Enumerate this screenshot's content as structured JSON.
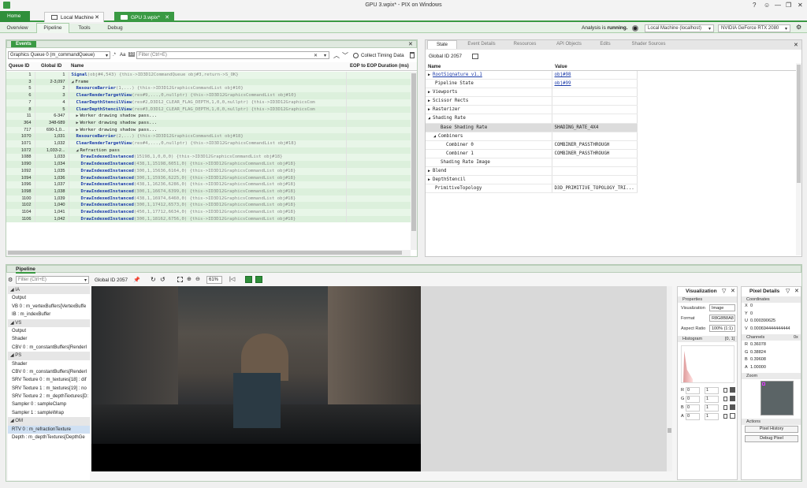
{
  "window": {
    "title": "GPU 3.wpix* - PIX on Windows",
    "help": "?",
    "min": "—",
    "max": "❐",
    "close": "✕"
  },
  "tabs": {
    "home": "Home",
    "docs": [
      {
        "label": "Local Machine"
      },
      {
        "label": "GPU 3.wpix*"
      }
    ]
  },
  "ribbon": {
    "tabs": [
      "Overview",
      "Pipeline",
      "Tools",
      "Debug"
    ],
    "analysis_prefix": "Analysis is",
    "analysis_state": "running.",
    "machine": "Local Machine (localhost)",
    "adapter": "NVIDIA GeForce RTX 2080"
  },
  "events": {
    "title": "Events",
    "queue": "Graphics Queue 0 (m_commandQueue)",
    "regex": ".*",
    "case": "Aa",
    "whole": "10",
    "filter_placeholder": "Filter (Ctrl+E)",
    "collect": "Collect Timing Data",
    "columns": [
      "Queue ID",
      "Global ID",
      "Name",
      "EOP to EOP Duration (ms)"
    ],
    "rows": [
      {
        "q": "1",
        "g": "1",
        "indent": 0,
        "exp": "",
        "fn": "Signal",
        "args": "(obj#4,543)  {this->ID3D12CommandQueue obj#3,return->S_OK}",
        "plain": ""
      },
      {
        "q": "3",
        "g": "2-3,097",
        "indent": 0,
        "exp": "◢",
        "fn": "",
        "args": "",
        "plain": "Frame"
      },
      {
        "q": "5",
        "g": "2",
        "indent": 1,
        "exp": "",
        "fn": "ResourceBarrier",
        "args": "(1,...)  {this->ID3D12GraphicsCommandList obj#10}",
        "plain": ""
      },
      {
        "q": "6",
        "g": "3",
        "indent": 1,
        "exp": "",
        "fn": "ClearRenderTargetView",
        "args": "(res#9,...,0,nullptr)  {this->ID3D12GraphicsCommandList obj#10}",
        "plain": ""
      },
      {
        "q": "7",
        "g": "4",
        "indent": 1,
        "exp": "",
        "fn": "ClearDepthStencilView",
        "args": "(res#2,D3D12_CLEAR_FLAG_DEPTH,1,0,0,nullptr)  {this->ID3D12GraphicsCom",
        "plain": ""
      },
      {
        "q": "8",
        "g": "5",
        "indent": 1,
        "exp": "",
        "fn": "ClearDepthStencilView",
        "args": "(res#3,D3D12_CLEAR_FLAG_DEPTH,1,0,0,nullptr)  {this->ID3D12GraphicsCom",
        "plain": ""
      },
      {
        "q": "11",
        "g": "6-347",
        "indent": 1,
        "exp": "▶",
        "fn": "",
        "args": "",
        "plain": "Worker drawing shadow pass..."
      },
      {
        "q": "364",
        "g": "348-689",
        "indent": 1,
        "exp": "▶",
        "fn": "",
        "args": "",
        "plain": "Worker drawing shadow pass..."
      },
      {
        "q": "717",
        "g": "690-1,0...",
        "indent": 1,
        "exp": "▶",
        "fn": "",
        "args": "",
        "plain": "Worker drawing shadow pass..."
      },
      {
        "q": "1070",
        "g": "1,031",
        "indent": 1,
        "exp": "",
        "fn": "ResourceBarrier",
        "args": "(2,...)  {this->ID3D12GraphicsCommandList obj#18}",
        "plain": ""
      },
      {
        "q": "1071",
        "g": "1,032",
        "indent": 1,
        "exp": "",
        "fn": "ClearRenderTargetView",
        "args": "(res#4,...,0,nullptr)  {this->ID3D12GraphicsCommandList obj#18}",
        "plain": ""
      },
      {
        "q": "1072",
        "g": "1,033-2...",
        "indent": 1,
        "exp": "◢",
        "fn": "",
        "args": "",
        "plain": "Refraction pass"
      },
      {
        "q": "1088",
        "g": "1,033",
        "indent": 2,
        "exp": "",
        "fn": "DrawIndexedInstanced",
        "args": "(15198,1,0,0,0)  {this->ID3D12GraphicsCommandList obj#18}",
        "plain": ""
      },
      {
        "q": "1090",
        "g": "1,034",
        "indent": 2,
        "exp": "",
        "fn": "DrawIndexedInstanced",
        "args": "(438,1,15198,6051,0)  {this->ID3D12GraphicsCommandList obj#18}",
        "plain": ""
      },
      {
        "q": "1092",
        "g": "1,035",
        "indent": 2,
        "exp": "",
        "fn": "DrawIndexedInstanced",
        "args": "(300,1,15636,6164,0)  {this->ID3D12GraphicsCommandList obj#18}",
        "plain": ""
      },
      {
        "q": "1094",
        "g": "1,036",
        "indent": 2,
        "exp": "",
        "fn": "DrawIndexedInstanced",
        "args": "(300,1,15936,6225,0)  {this->ID3D12GraphicsCommandList obj#18}",
        "plain": ""
      },
      {
        "q": "1096",
        "g": "1,037",
        "indent": 2,
        "exp": "",
        "fn": "DrawIndexedInstanced",
        "args": "(438,1,16236,6286,0)  {this->ID3D12GraphicsCommandList obj#18}",
        "plain": ""
      },
      {
        "q": "1098",
        "g": "1,038",
        "indent": 2,
        "exp": "",
        "fn": "DrawIndexedInstanced",
        "args": "(300,1,16674,6399,0)  {this->ID3D12GraphicsCommandList obj#18}",
        "plain": ""
      },
      {
        "q": "1100",
        "g": "1,039",
        "indent": 2,
        "exp": "",
        "fn": "DrawIndexedInstanced",
        "args": "(438,1,16974,6460,0)  {this->ID3D12GraphicsCommandList obj#18}",
        "plain": ""
      },
      {
        "q": "1102",
        "g": "1,040",
        "indent": 2,
        "exp": "",
        "fn": "DrawIndexedInstanced",
        "args": "(300,1,17412,6573,0)  {this->ID3D12GraphicsCommandList obj#18}",
        "plain": ""
      },
      {
        "q": "1104",
        "g": "1,041",
        "indent": 2,
        "exp": "",
        "fn": "DrawIndexedInstanced",
        "args": "(450,1,17712,6634,0)  {this->ID3D12GraphicsCommandList obj#18}",
        "plain": ""
      },
      {
        "q": "1106",
        "g": "1,042",
        "indent": 2,
        "exp": "",
        "fn": "DrawIndexedInstanced",
        "args": "(300,1,18162,6756,0)  {this->ID3D12GraphicsCommandList obj#18}",
        "plain": ""
      }
    ]
  },
  "state": {
    "tabs": [
      "State",
      "Event Details",
      "Resources",
      "API Objects",
      "Edits",
      "Shader Sources"
    ],
    "global_id": "Global ID 2057",
    "columns": [
      "Name",
      "Value"
    ],
    "rows": [
      {
        "indent": 0,
        "exp": "▶",
        "name": "RootSignature v1.1",
        "value": "obj#98",
        "link_name": true,
        "link_val": true,
        "hl": false
      },
      {
        "indent": 0,
        "exp": "",
        "name": "Pipeline State",
        "value": "obj#99",
        "link_name": false,
        "link_val": true,
        "hl": false
      },
      {
        "indent": 0,
        "exp": "▶",
        "name": "Viewports",
        "value": "",
        "hl": false
      },
      {
        "indent": 0,
        "exp": "▶",
        "name": "Scissor Rects",
        "value": "",
        "hl": false
      },
      {
        "indent": 0,
        "exp": "▶",
        "name": "Rasterizer",
        "value": "",
        "hl": false
      },
      {
        "indent": 0,
        "exp": "◢",
        "name": "Shading Rate",
        "value": "",
        "hl": false
      },
      {
        "indent": 1,
        "exp": "",
        "name": "Base Shading Rate",
        "value": "SHADING_RATE_4X4",
        "hl": true
      },
      {
        "indent": 1,
        "exp": "◢",
        "name": "Combiners",
        "value": "",
        "hl": false
      },
      {
        "indent": 2,
        "exp": "",
        "name": "Combiner 0",
        "value": "COMBINER_PASSTHROUGH",
        "hl": false
      },
      {
        "indent": 2,
        "exp": "",
        "name": "Combiner 1",
        "value": "COMBINER_PASSTHROUGH",
        "hl": false
      },
      {
        "indent": 1,
        "exp": "",
        "name": "Shading Rate Image",
        "value": "",
        "hl": false
      },
      {
        "indent": 0,
        "exp": "▶",
        "name": "Blend",
        "value": "",
        "hl": false
      },
      {
        "indent": 0,
        "exp": "▶",
        "name": "DepthStencil",
        "value": "",
        "hl": false
      },
      {
        "indent": 0,
        "exp": "",
        "name": "PrimitiveTopology",
        "value": "D3D_PRIMITIVE_TOPOLOGY_TRI...",
        "hl": false
      }
    ]
  },
  "pipeline": {
    "title": "Pipeline",
    "filter_placeholder": "Filter (Ctrl+E)",
    "global_id": "Global ID 2057",
    "zoom": "61%",
    "items": [
      {
        "t": "◢ IA",
        "kind": "sec"
      },
      {
        "t": "Output",
        "kind": ""
      },
      {
        "t": "VB 0 : m_vertexBuffers[VertexBuffe",
        "kind": ""
      },
      {
        "t": "IB : m_indexBuffer",
        "kind": ""
      },
      {
        "t": "◢ VS",
        "kind": "sec"
      },
      {
        "t": "Output",
        "kind": ""
      },
      {
        "t": "Shader",
        "kind": ""
      },
      {
        "t": "CBV 0 : m_constantBuffers[Renderl",
        "kind": ""
      },
      {
        "t": "◢ PS",
        "kind": "sec"
      },
      {
        "t": "Shader",
        "kind": ""
      },
      {
        "t": "CBV 0 : m_constantBuffers[Renderl",
        "kind": ""
      },
      {
        "t": "SRV Texture 0 : m_textures[18] : dif",
        "kind": ""
      },
      {
        "t": "SRV Texture 1 : m_textures[19] : no",
        "kind": ""
      },
      {
        "t": "SRV Texture 2 : m_depthTextures[D:",
        "kind": ""
      },
      {
        "t": "Sampler 0 : sampleClamp",
        "kind": ""
      },
      {
        "t": "Sampler 1 : sampleWrap",
        "kind": ""
      },
      {
        "t": "◢ OM",
        "kind": "sec"
      },
      {
        "t": "RTV 0 : m_refractionTexture",
        "kind": "sel"
      },
      {
        "t": "Depth : m_depthTextures[DepthGe",
        "kind": ""
      }
    ]
  },
  "viz": {
    "title": "Visualization",
    "properties": "Properties",
    "vis_label": "Visualization",
    "vis_val": "Image",
    "fmt_label": "Format",
    "fmt_val": "R8G8B8A8",
    "ar_label": "Aspect Ratio",
    "ar_val": "100% (1:1)",
    "histogram": "Histogram",
    "hist_range": "[0, 1]",
    "channels": [
      {
        "c": "R",
        "lo": "0",
        "hi": "1"
      },
      {
        "c": "G",
        "lo": "0",
        "hi": "1"
      },
      {
        "c": "B",
        "lo": "0",
        "hi": "1"
      },
      {
        "c": "A",
        "lo": "0",
        "hi": "1"
      }
    ]
  },
  "pixel": {
    "title": "Pixel Details",
    "coords": "Coordinates",
    "coord_rows": [
      {
        "k": "X",
        "v": "0"
      },
      {
        "k": "Y",
        "v": "0"
      },
      {
        "k": "U",
        "v": "0.000390625"
      },
      {
        "k": "V",
        "v": "0.000694444444444"
      }
    ],
    "channels": "Channels",
    "ch_fmt": "0x",
    "ch_rows": [
      {
        "k": "R",
        "v": "0.36078"
      },
      {
        "k": "G",
        "v": "0.38824"
      },
      {
        "k": "B",
        "v": "0.39608"
      },
      {
        "k": "A",
        "v": "1.00000"
      }
    ],
    "zoom": "Zoom",
    "actions": "Actions",
    "history": "Pixel History",
    "debug": "Debug Pixel"
  }
}
